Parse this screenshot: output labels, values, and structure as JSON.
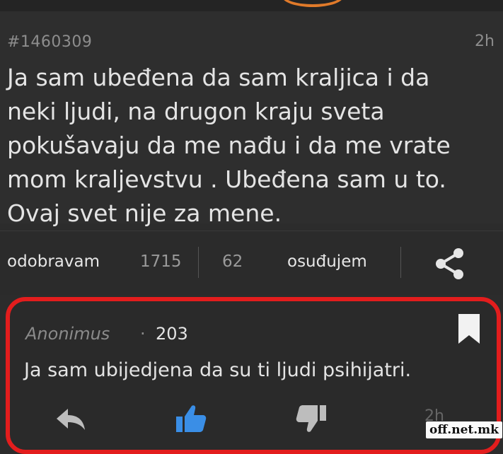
{
  "post": {
    "id": "#1460309",
    "time": "2h",
    "text_lines": [
      "Ja sam ubeđena da sam kraljica i da",
      "neki ljudi, na drugon kraju sveta",
      "pokušavaju da me nađu i da me vrate",
      "mom kraljevstvu . Ubeđena sam u to.",
      "Ovaj svet nije za mene."
    ]
  },
  "actions": {
    "approve_label": "odobravam",
    "approve_count": "1715",
    "condemn_count": "62",
    "condemn_label": "osuđujem",
    "share_icon": "share-icon"
  },
  "comment": {
    "author": "Anonimus",
    "separator": "·",
    "score": "203",
    "text": "Ja sam ubijedjena da su ti ljudi psihijatri.",
    "time": "2h",
    "icons": [
      "reply-icon",
      "thumbs-up-icon",
      "thumbs-down-icon",
      "bookmark-icon"
    ]
  },
  "colors": {
    "highlight_border": "#e31d1d",
    "like_blue": "#3a8ee6",
    "top_accent": "#e07a2a"
  },
  "watermark": "off.net.mk"
}
